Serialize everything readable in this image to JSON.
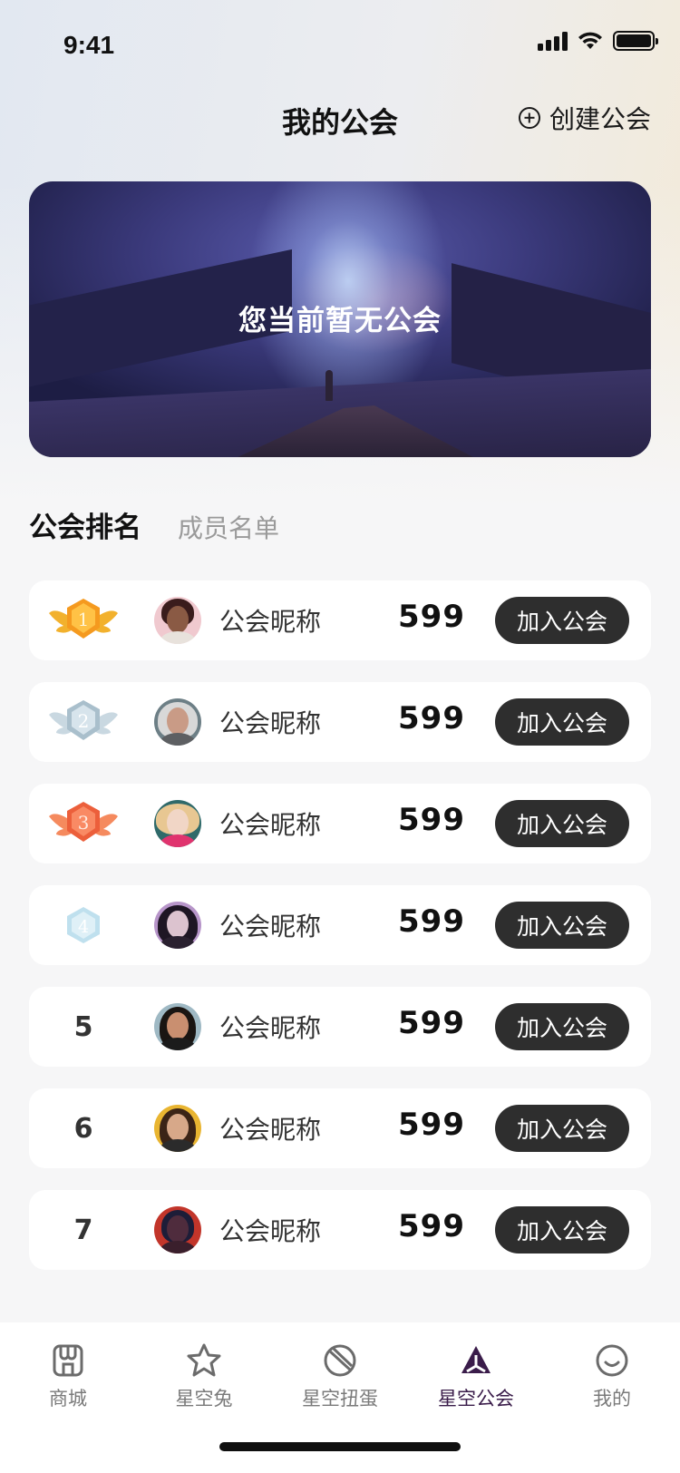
{
  "status": {
    "time": "9:41"
  },
  "header": {
    "title": "我的公会",
    "create_label": "创建公会"
  },
  "banner": {
    "text": "您当前暂无公会"
  },
  "tabs": {
    "active": "公会排名",
    "inactive": "成员名单"
  },
  "ranking": [
    {
      "rank": "1",
      "badge": "gold-medal-icon",
      "name": "公会昵称",
      "score": "599",
      "button": "加入公会"
    },
    {
      "rank": "2",
      "badge": "silver-medal-icon",
      "name": "公会昵称",
      "score": "599",
      "button": "加入公会"
    },
    {
      "rank": "3",
      "badge": "bronze-medal-icon",
      "name": "公会昵称",
      "score": "599",
      "button": "加入公会"
    },
    {
      "rank": "4",
      "badge": "crystal-medal-icon",
      "name": "公会昵称",
      "score": "599",
      "button": "加入公会"
    },
    {
      "rank": "5",
      "name": "公会昵称",
      "score": "599",
      "button": "加入公会"
    },
    {
      "rank": "6",
      "name": "公会昵称",
      "score": "599",
      "button": "加入公会"
    },
    {
      "rank": "7",
      "name": "公会昵称",
      "score": "599",
      "button": "加入公会"
    }
  ],
  "bottom_nav": [
    {
      "label": "商城",
      "icon": "shop-icon"
    },
    {
      "label": "星空兔",
      "icon": "star-rabbit-icon"
    },
    {
      "label": "星空扭蛋",
      "icon": "gacha-ball-icon"
    },
    {
      "label": "星空公会",
      "icon": "guild-icon",
      "active": true
    },
    {
      "label": "我的",
      "icon": "smiley-icon"
    }
  ],
  "colors": {
    "join_button_bg": "#2e2e2e",
    "active_tab": "#3a1c4a",
    "gold": "#f5a623",
    "silver": "#b9cbd6",
    "bronze": "#f0704a",
    "crystal": "#cfe6f1"
  }
}
